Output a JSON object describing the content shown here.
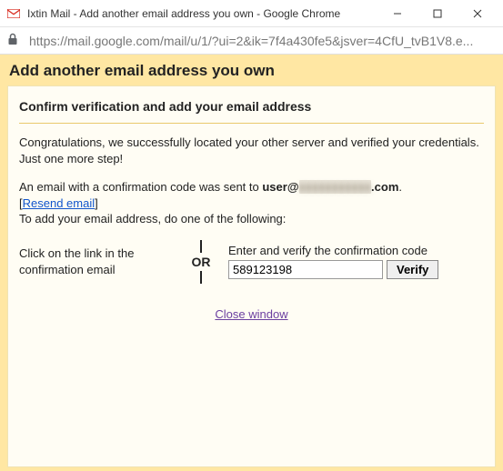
{
  "window": {
    "title": "Ixtin Mail - Add another email address you own - Google Chrome"
  },
  "address": {
    "url": "https://mail.google.com/mail/u/1/?ui=2&ik=7f4a430fe5&jsver=4CfU_tvB1V8.e..."
  },
  "page": {
    "header": "Add another email address you own",
    "subheader": "Confirm verification and add your email address",
    "congrats": "Congratulations, we successfully located your other server and verified your credentials. Just one more step!",
    "sent_prefix": "An email with a confirmation code was sent to ",
    "sent_user": "user@",
    "sent_domain_obscured": "xxxxxxxxxxx",
    "sent_suffix": ".com",
    "resend": "Resend email",
    "instruction": "To add your email address, do one of the following:",
    "left_option": "Click on the link in the confirmation email",
    "or_label": "OR",
    "right_label": "Enter and verify the confirmation code",
    "code_value": "589123198",
    "verify_label": "Verify",
    "close_label": "Close window"
  }
}
